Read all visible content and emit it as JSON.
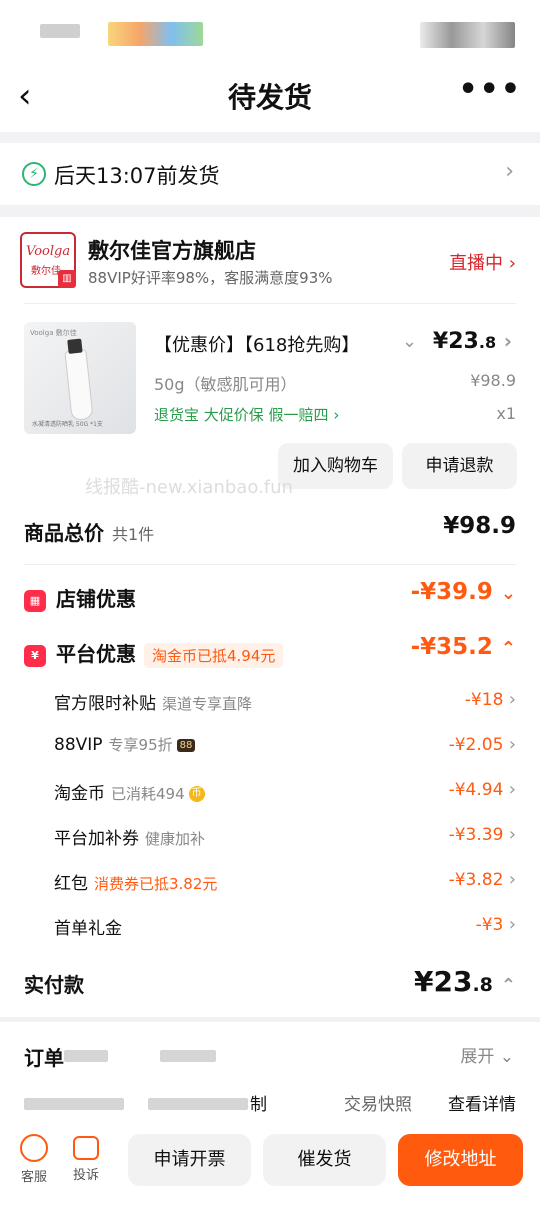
{
  "nav": {
    "back": "‹",
    "title": "待发货",
    "more": "•••"
  },
  "shipping": {
    "text": "后天13:07前发货"
  },
  "shop": {
    "logo_text": "Voolga",
    "logo_sub": "敷尔佳",
    "name": "敷尔佳官方旗舰店",
    "rating": "88VIP好评率98%，客服满意度93%",
    "live": "直播中"
  },
  "product": {
    "title": "【优惠价】【618抢先购】",
    "price_main": "¥23",
    "price_dec": ".8",
    "spec": "50g（敏感肌可用）",
    "original_price": "¥98.9",
    "tags": "退货宝  大促价保  假一赔四",
    "qty": "x1",
    "btn_cart": "加入购物车",
    "btn_refund": "申请退款",
    "img_brand": "Voolga 敷尔佳",
    "img_caption": "水凝清透防晒乳 50G *1支"
  },
  "watermark": "线报酷-new.xianbao.fun",
  "summary": {
    "total_label": "商品总价",
    "total_count": "共1件",
    "total_value": "¥98.9",
    "shop_discount_label": "店铺优惠",
    "shop_discount_value": "-¥39.9",
    "platform_label": "平台优惠",
    "platform_tag": "淘金币已抵4.94元",
    "platform_value": "-¥35.2",
    "items": [
      {
        "label": "官方限时补贴",
        "note": "渠道专享直降",
        "value": "-¥18"
      },
      {
        "label": "88VIP",
        "note": "专享95折",
        "badge": "88",
        "value": "-¥2.05"
      },
      {
        "label": "淘金币",
        "note": "已消耗494",
        "value": "-¥4.94"
      },
      {
        "label": "平台加补券",
        "note": "健康加补",
        "value": "-¥3.39"
      },
      {
        "label": "红包",
        "note": "消费券已抵3.82元",
        "value": "-¥3.82"
      },
      {
        "label": "首单礼金",
        "note": "",
        "value": "-¥3"
      }
    ],
    "paid_label": "实付款",
    "paid_main": "¥23",
    "paid_dec": ".8"
  },
  "order": {
    "label": "订单",
    "expand": "展开",
    "partial": "制",
    "snapshot": "交易快照",
    "detail": "查看详情"
  },
  "bottom": {
    "service": "客服",
    "complaint": "投诉",
    "invoice": "申请开票",
    "urge": "催发货",
    "modify": "修改地址"
  },
  "colors": {
    "accent": "#ff5a11",
    "green": "#2a9d4b",
    "live_red": "#d9262c"
  }
}
